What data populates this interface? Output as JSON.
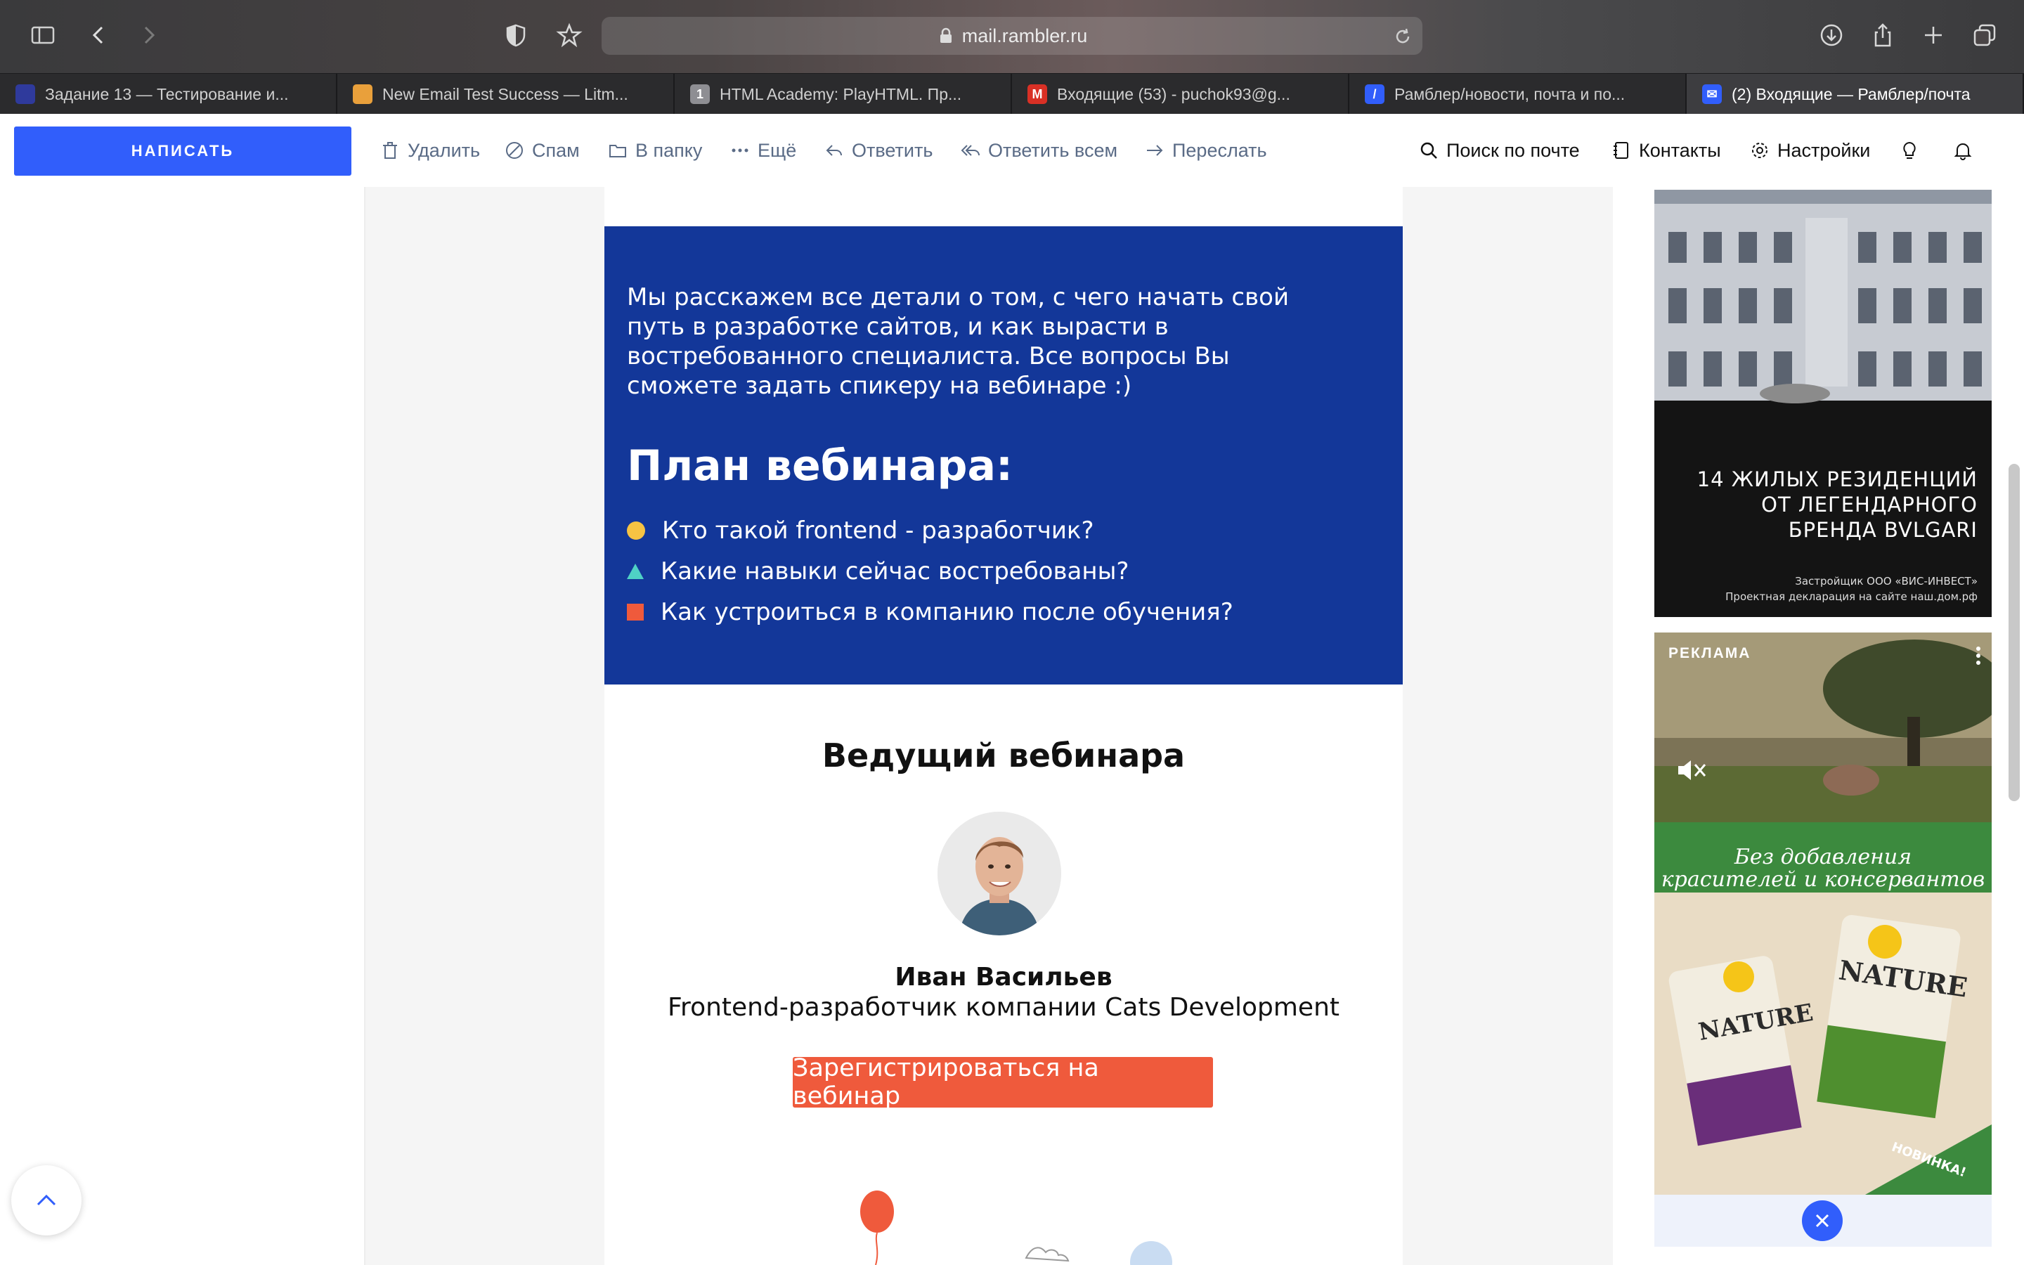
{
  "browser": {
    "url": "mail.rambler.ru",
    "tabs": [
      {
        "title": "Задание 13 — Тестирование и...",
        "icon": "square-blue-icon",
        "color": "#2f3a9c",
        "glyph": ""
      },
      {
        "title": "New Email Test Success — Litm...",
        "icon": "litmus-icon",
        "color": "#e9a03b",
        "glyph": ""
      },
      {
        "title": "HTML Academy: PlayHTML. Пр...",
        "icon": "number-one-icon",
        "color": "#8e8e93",
        "glyph": "1"
      },
      {
        "title": "Входящие (53) - puchok93@g...",
        "icon": "gmail-icon",
        "color": "#d93025",
        "glyph": "M"
      },
      {
        "title": "Рамблер/новости, почта и по...",
        "icon": "rambler-icon",
        "color": "#315efb",
        "glyph": "/"
      },
      {
        "title": "(2) Входящие — Рамблер/почта",
        "icon": "mail-envelope-icon",
        "color": "#315efb",
        "glyph": "✉"
      }
    ]
  },
  "toolbar": {
    "compose_label": "НАПИСАТЬ",
    "delete_label": "Удалить",
    "spam_label": "Спам",
    "folder_label": "В папку",
    "more_label": "Ещё",
    "reply_label": "Ответить",
    "reply_all_label": "Ответить всем",
    "forward_label": "Переслать",
    "search_label": "Поиск по почте",
    "contacts_label": "Контакты",
    "settings_label": "Настройки"
  },
  "email": {
    "intro": "Мы расскажем все детали о том, с чего начать свой путь в разработке сайтов, и как вырасти в востребованного специалиста. Все вопросы Вы сможете задать спикеру на вебинаре :)",
    "plan_title": "План вебинара:",
    "plan_items": [
      "Кто такой frontend - разработчик?",
      "Какие навыки сейчас востребованы?",
      "Как устроиться в компанию после обучения?"
    ],
    "host_title": "Ведущий вебинара",
    "host_name": "Иван Васильев",
    "host_role": "Frontend-разработчик компании Cats Development",
    "register_label": "Зарегистрироваться на вебинар",
    "colors": {
      "block": "#133799",
      "button": "#ef5a3c",
      "bullet_circle": "#f6c343",
      "bullet_triangle": "#4fd1c5",
      "bullet_square": "#ef5a3c"
    }
  },
  "ads": {
    "ad1_line1": "14 ЖИЛЫХ РЕЗИДЕНЦИЙ",
    "ad1_line2": "ОТ ЛЕГЕНДАРНОГО",
    "ad1_line3": "БРЕНДА BVLGARI",
    "ad1_fine1": "Застройщик ООО «ВИС-ИНВЕСТ»",
    "ad1_fine2": "Проектная декларация на сайте наш.дом.рф",
    "ad2_label": "РЕКЛАМА",
    "ad3_line1": "Без добавления",
    "ad3_line2": "красителей и консервантов",
    "ad3_brand": "NATURE",
    "ad3_badge": "НОВИНКА!"
  }
}
